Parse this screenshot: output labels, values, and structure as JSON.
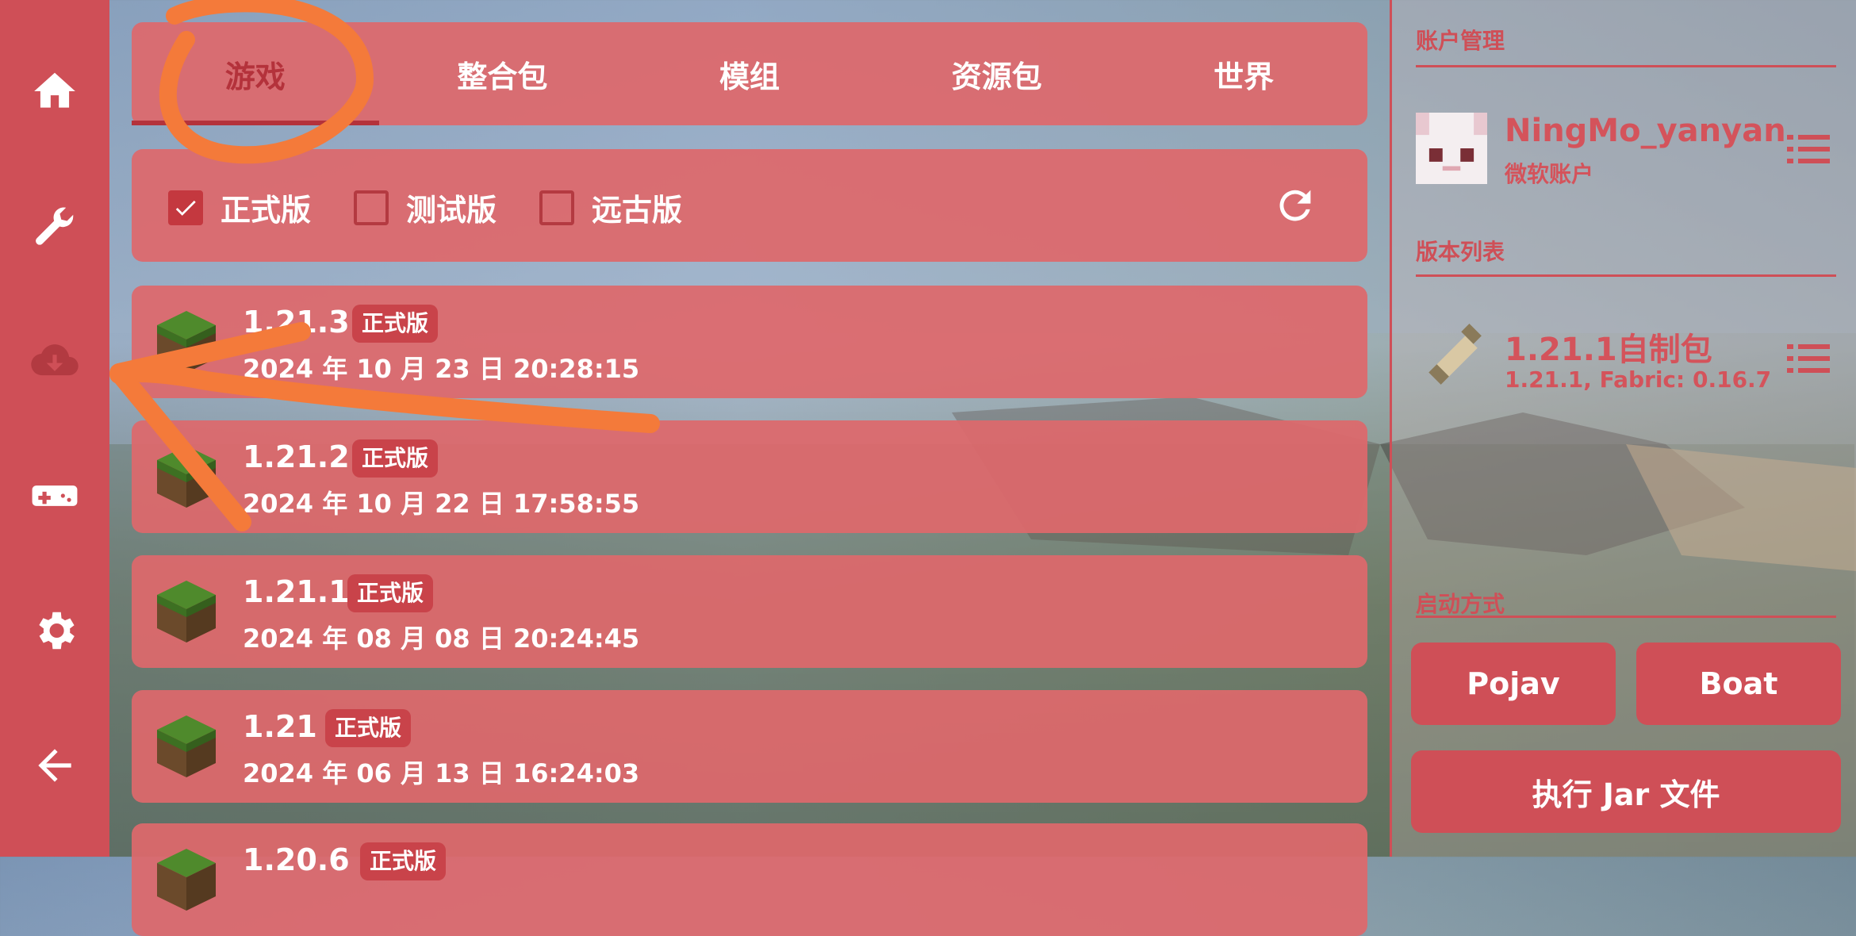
{
  "sidebar": {
    "items": [
      {
        "icon": "home-icon"
      },
      {
        "icon": "wrench-icon"
      },
      {
        "icon": "cloud-download-icon"
      },
      {
        "icon": "gamepad-icon"
      },
      {
        "icon": "gear-icon"
      },
      {
        "icon": "back-arrow-icon"
      }
    ]
  },
  "tabs": [
    {
      "label": "游戏",
      "active": true
    },
    {
      "label": "整合包",
      "active": false
    },
    {
      "label": "模组",
      "active": false
    },
    {
      "label": "资源包",
      "active": false
    },
    {
      "label": "世界",
      "active": false
    }
  ],
  "filters": {
    "release": {
      "label": "正式版",
      "checked": true
    },
    "snapshot": {
      "label": "测试版",
      "checked": false
    },
    "old": {
      "label": "远古版",
      "checked": false
    },
    "refresh_icon": "refresh-icon"
  },
  "versions": [
    {
      "name": "1.21.3",
      "badge": "正式版",
      "date": "2024 年 10 月 23 日 20:28:15"
    },
    {
      "name": "1.21.2",
      "badge": "正式版",
      "date": "2024 年 10 月 22 日 17:58:55"
    },
    {
      "name": "1.21.1",
      "badge": "正式版",
      "date": "2024 年 08 月 08 日 20:24:45"
    },
    {
      "name": "1.21",
      "badge": "正式版",
      "date": "2024 年 06 月 13 日 16:24:03"
    },
    {
      "name": "1.20.6",
      "badge": "正式版",
      "date": ""
    }
  ],
  "right": {
    "account_title": "账户管理",
    "account_name": "NingMo_yanyan",
    "account_type": "微软账户",
    "version_list_title": "版本列表",
    "pack_name": "1.21.1自制包",
    "pack_detail": "1.21.1, Fabric: 0.16.7",
    "launch_title": "启动方式",
    "pojav_label": "Pojav",
    "boat_label": "Boat",
    "jar_label": "执行 Jar 文件"
  },
  "colors": {
    "accent": "#cf4f57",
    "panel": "#de686c",
    "annotation": "#f47a3a"
  }
}
